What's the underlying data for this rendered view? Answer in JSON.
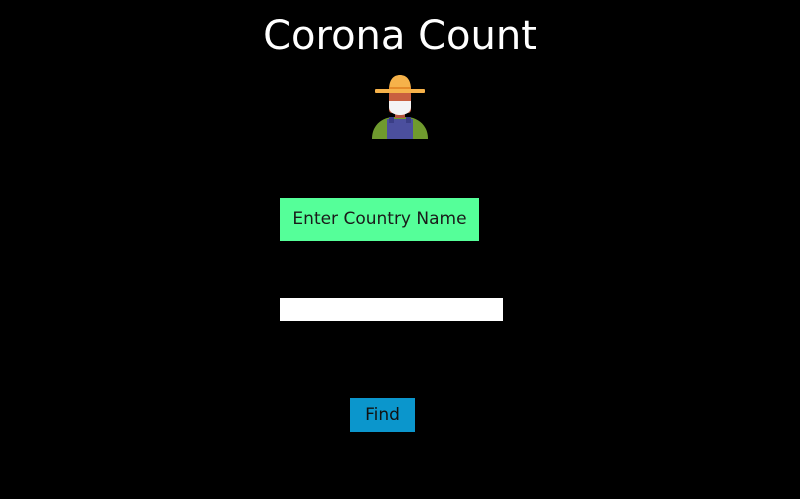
{
  "header": {
    "title": "Corona Count"
  },
  "form": {
    "label": "Enter Country Name",
    "input_value": "",
    "input_placeholder": "",
    "find_label": "Find"
  },
  "icons": {
    "avatar": "farmer-with-mask-icon"
  },
  "colors": {
    "background": "#000000",
    "title_text": "#ffffff",
    "label_bg": "#55ff99",
    "button_bg": "#0b96cc",
    "input_bg": "#ffffff"
  }
}
